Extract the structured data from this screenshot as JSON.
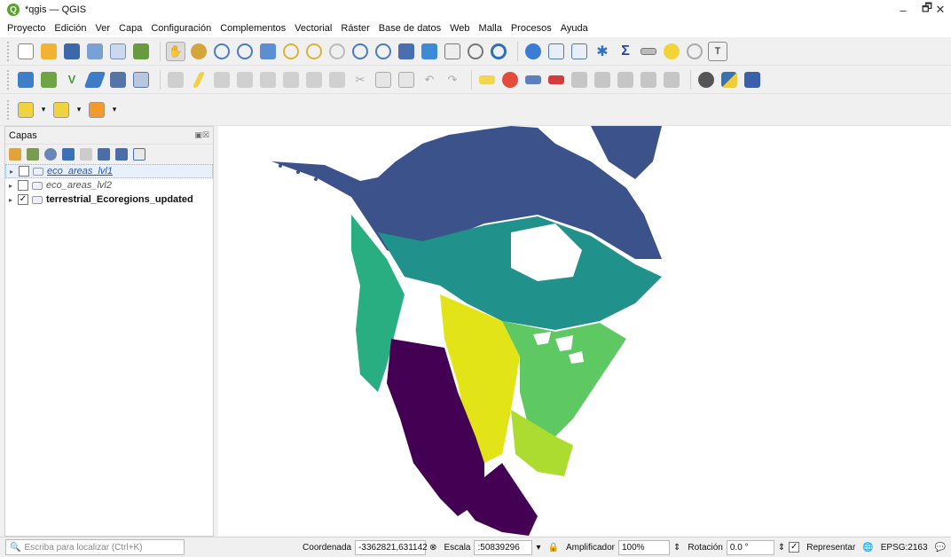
{
  "window": {
    "title": "*qgis — QGIS",
    "logo_letter": "Q",
    "minimize": "–",
    "maximize": "🗗",
    "close": "✕"
  },
  "menu": [
    "Proyecto",
    "Edición",
    "Ver",
    "Capa",
    "Configuración",
    "Complementos",
    "Vectorial",
    "Ráster",
    "Base de datos",
    "Web",
    "Malla",
    "Procesos",
    "Ayuda"
  ],
  "toolbar_icons": {
    "row1": [
      "new-project",
      "open-project",
      "save-project",
      "save-as",
      "print-layout",
      "style-manager",
      "pan",
      "pan-to-selection",
      "zoom-in",
      "zoom-out",
      "zoom-full",
      "zoom-selection",
      "zoom-layer",
      "zoom-native",
      "zoom-last",
      "zoom-next",
      "new-bookmark",
      "show-bookmarks",
      "temporal",
      "refresh",
      "identify",
      "attribute-table",
      "field-calculator",
      "processing-toolbox",
      "statistics",
      "measure",
      "map-tips",
      "select-location",
      "text-annotation"
    ],
    "row2": [
      "data-source-manager",
      "new-layer",
      "digitize",
      "toggle-editing",
      "save-edits",
      "add-feature",
      "vertex-tool",
      "delete-selected",
      "cut",
      "copy",
      "paste",
      "undo",
      "redo",
      "label-tool",
      "diagram-tool",
      "pin-labels",
      "show-hide-labels",
      "move-label",
      "rotate-label",
      "change-label",
      "globe",
      "python",
      "help"
    ],
    "row3": [
      "select-features",
      "deselect",
      "select-by-expression"
    ]
  },
  "layers_panel": {
    "title": "Capas",
    "controls": "▣☒",
    "layers": [
      {
        "name": "eco_areas_lvl1",
        "checked": "",
        "style": "link",
        "selected": true
      },
      {
        "name": "eco_areas_lvl2",
        "checked": "",
        "style": "italic",
        "selected": false
      },
      {
        "name": "terrestrial_Ecoregions_updated",
        "checked": "✓",
        "style": "bold",
        "selected": false
      }
    ]
  },
  "map": {
    "palette": [
      "#3b528b",
      "#2c728e",
      "#21918c",
      "#28ae80",
      "#5ec962",
      "#addc30",
      "#e3e418",
      "#440154"
    ],
    "lake_color": "#ffffff",
    "greenland_color": "#3b528b"
  },
  "status": {
    "locator_placeholder": "Escriba para localizar (Ctrl+K)",
    "coordinate_label": "Coordenada",
    "coordinate_value": "-3362821,631142",
    "scale_label": "Escala",
    "scale_value": ":50839296",
    "magnifier_label": "Amplificador",
    "magnifier_value": "100%",
    "rotation_label": "Rotación",
    "rotation_value": "0.0 °",
    "render_label": "Representar",
    "render_checked": "✓",
    "crs": "EPSG:2163"
  }
}
